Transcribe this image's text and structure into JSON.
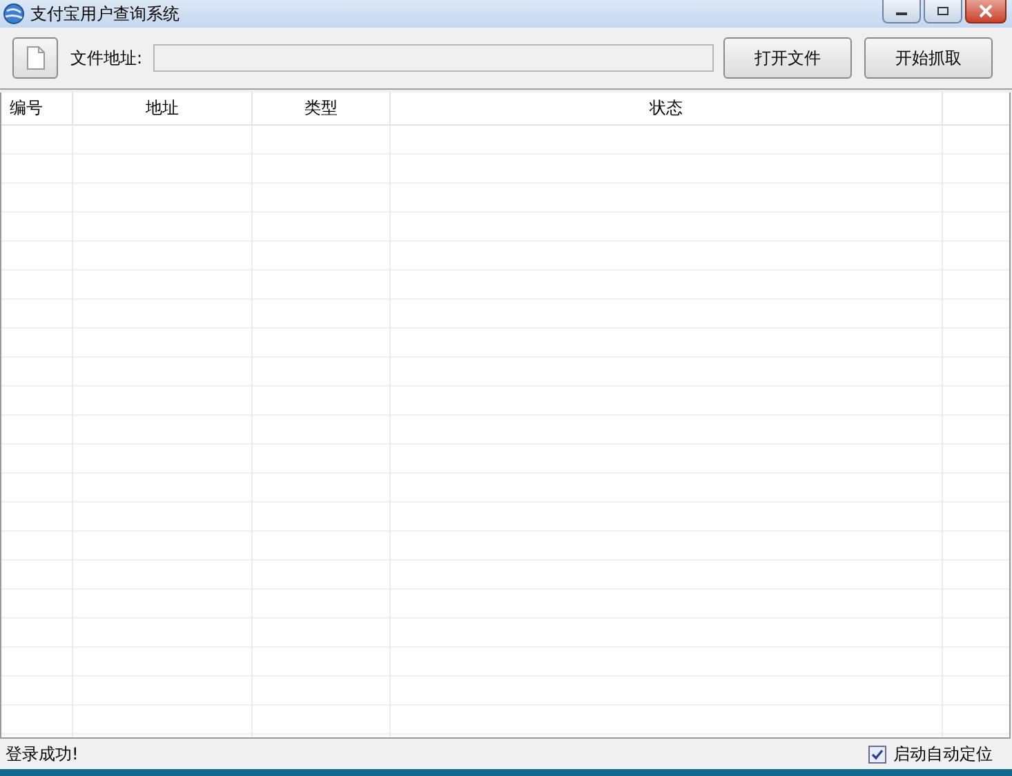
{
  "window": {
    "title": "支付宝用户查询系统"
  },
  "toolbar": {
    "file_label": "文件地址:",
    "buttons": [
      "打开文件",
      "开始抓取"
    ]
  },
  "table": {
    "columns": [
      "编号",
      "地址",
      "类型",
      "状态"
    ]
  },
  "status_bar": {
    "message": "登录成功!",
    "auto_locate": {
      "label": "启动自动定位",
      "checked": true
    }
  }
}
